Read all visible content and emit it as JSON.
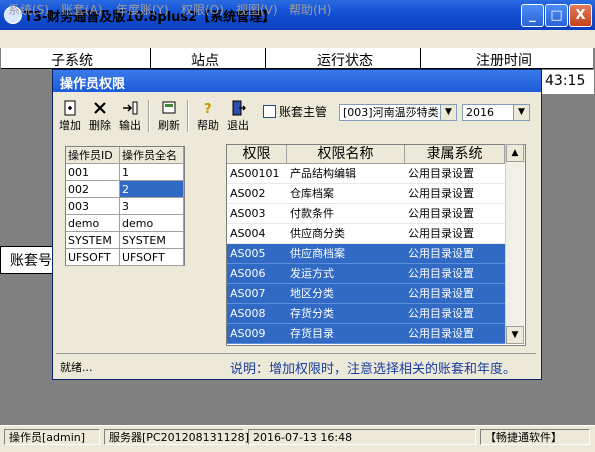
{
  "window": {
    "title": "T3-财务通普及版10.8plus2【系统管理】",
    "buttons": [
      "_",
      "□",
      "X"
    ]
  },
  "menu": [
    "系统(S)",
    "账套(A)",
    "年度账(Y)",
    "权限(O)",
    "视图(V)",
    "帮助(H)"
  ],
  "background_table": {
    "columns": [
      "子系统",
      "站点",
      "运行状态",
      "注册时间"
    ],
    "time_fragment": "43:15",
    "side_label": "账套号"
  },
  "dialog": {
    "title": "操作员权限",
    "toolbar": [
      {
        "label": "增加",
        "icon": "add-doc-icon"
      },
      {
        "label": "删除",
        "icon": "delete-x-icon"
      },
      {
        "label": "输出",
        "icon": "export-icon"
      },
      {
        "label": "刷新",
        "icon": "refresh-icon"
      },
      {
        "label": "帮助",
        "icon": "help-icon"
      },
      {
        "label": "退出",
        "icon": "exit-door-icon"
      }
    ],
    "account_master_label": "账套主管",
    "account_select": "[003]河南温莎特类",
    "year_select": "2016",
    "operators": {
      "headers": [
        "操作员ID",
        "操作员全名"
      ],
      "rows": [
        {
          "id": "001",
          "name": "1",
          "selected": false
        },
        {
          "id": "002",
          "name": "2",
          "selected": true
        },
        {
          "id": "003",
          "name": "3",
          "selected": false
        },
        {
          "id": "demo",
          "name": "demo",
          "selected": false
        },
        {
          "id": "SYSTEM",
          "name": "SYSTEM",
          "selected": false
        },
        {
          "id": "UFSOFT",
          "name": "UFSOFT",
          "selected": false
        }
      ]
    },
    "permissions": {
      "headers": [
        "权限",
        "权限名称",
        "隶属系统"
      ],
      "rows": [
        {
          "code": "AS00101",
          "name": "产品结构编辑",
          "system": "公用目录设置",
          "selected": false
        },
        {
          "code": "AS002",
          "name": "仓库档案",
          "system": "公用目录设置",
          "selected": false
        },
        {
          "code": "AS003",
          "name": "付款条件",
          "system": "公用目录设置",
          "selected": false
        },
        {
          "code": "AS004",
          "name": "供应商分类",
          "system": "公用目录设置",
          "selected": false
        },
        {
          "code": "AS005",
          "name": "供应商档案",
          "system": "公用目录设置",
          "selected": true
        },
        {
          "code": "AS006",
          "name": "发运方式",
          "system": "公用目录设置",
          "selected": true
        },
        {
          "code": "AS007",
          "name": "地区分类",
          "system": "公用目录设置",
          "selected": true
        },
        {
          "code": "AS008",
          "name": "存货分类",
          "system": "公用目录设置",
          "selected": true
        },
        {
          "code": "AS009",
          "name": "存货目录",
          "system": "公用目录设置",
          "selected": true
        }
      ]
    },
    "status": "就绪...",
    "hint": "说明：增加权限时，注意选择相关的账套和年度。"
  },
  "statusbar": [
    "操作员[admin]",
    "服务器[PC201208131128]",
    "2016-07-13 16:48",
    "【畅捷通软件】"
  ],
  "colors": {
    "selection": "#316ac5",
    "titlebar": "#1c5bd9",
    "hint": "#1a3d9c"
  }
}
